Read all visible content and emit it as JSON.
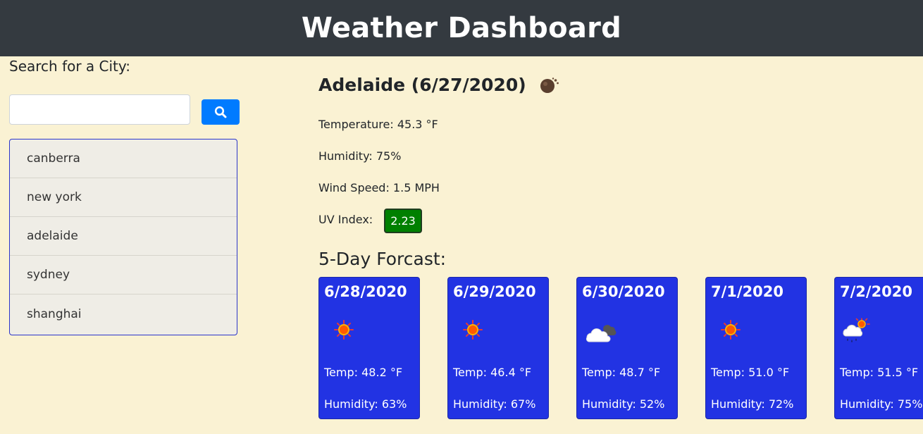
{
  "header": {
    "title": "Weather Dashboard"
  },
  "search": {
    "label": "Search for a City:",
    "value": "",
    "placeholder": "",
    "button_icon": "search-icon"
  },
  "history": {
    "items": [
      {
        "label": "canberra"
      },
      {
        "label": "new york"
      },
      {
        "label": "adelaide"
      },
      {
        "label": "sydney"
      },
      {
        "label": "shanghai"
      }
    ]
  },
  "current": {
    "title": "Adelaide (6/27/2020)",
    "icon": "dust-icon",
    "temperature": "Temperature: 45.3 °F",
    "humidity": "Humidity: 75%",
    "wind": "Wind Speed: 1.5 MPH",
    "uv_label": "UV Index:",
    "uv_value": "2.23",
    "uv_color": "#008000"
  },
  "forecast": {
    "title": "5-Day Forcast:",
    "card_color": "#2233e3",
    "days": [
      {
        "date": "6/28/2020",
        "icon": "sun-icon",
        "temp": "Temp: 48.2 °F",
        "humidity": "Humidity: 63%"
      },
      {
        "date": "6/29/2020",
        "icon": "sun-icon",
        "temp": "Temp: 46.4 °F",
        "humidity": "Humidity: 67%"
      },
      {
        "date": "6/30/2020",
        "icon": "cloudy-icon",
        "temp": "Temp: 48.7 °F",
        "humidity": "Humidity: 52%"
      },
      {
        "date": "7/1/2020",
        "icon": "sun-icon",
        "temp": "Temp: 51.0 °F",
        "humidity": "Humidity: 72%"
      },
      {
        "date": "7/2/2020",
        "icon": "rain-sun-icon",
        "temp": "Temp: 51.5 °F",
        "humidity": "Humidity: 75%"
      }
    ]
  }
}
